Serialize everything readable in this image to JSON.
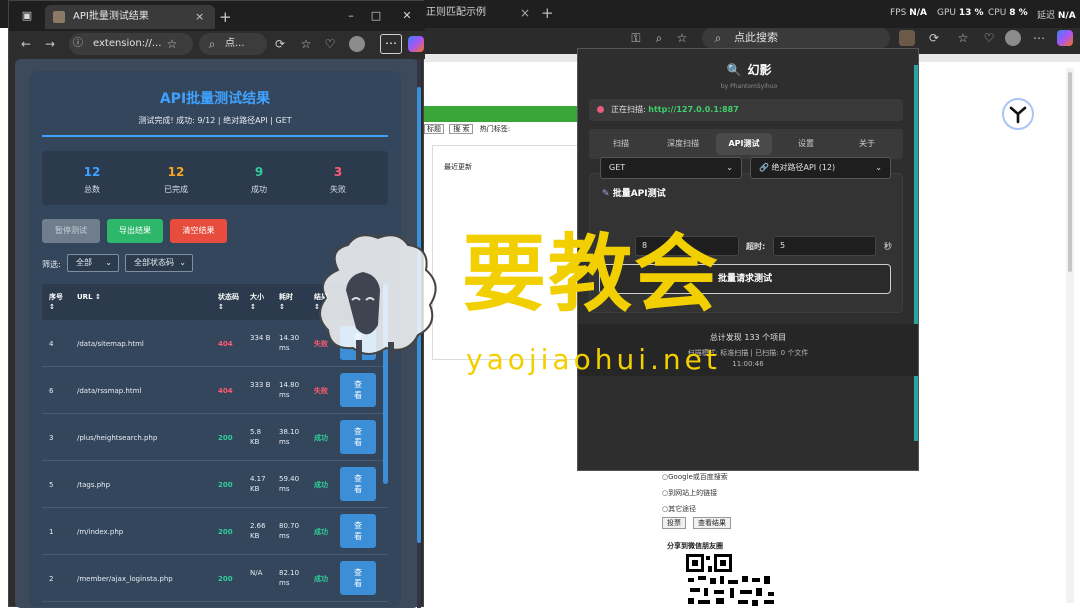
{
  "background_browser": {
    "tab_title": "正则匹配示例",
    "tab_close": "×",
    "new_tab": "+",
    "stats": [
      {
        "label": "FPS",
        "value": "N/A"
      },
      {
        "label": "GPU",
        "value": "13 %"
      },
      {
        "label": "CPU",
        "value": "8 %"
      },
      {
        "label": "延迟",
        "value": "N/A"
      }
    ],
    "search_placeholder": "点此搜索",
    "page": {
      "nav_search_btn": "搜 索",
      "nav_hot": "热门标签:",
      "nav_select": "标题",
      "recent_title": "最近更新",
      "radios": [
        "Google或百度搜索",
        "到网站上的链接",
        "其它途径"
      ],
      "submit_btn": "投票",
      "view_btn": "查看结果",
      "share_title": "分享到微信朋友圈"
    }
  },
  "front_window": {
    "tab_title": "API批量测试结果",
    "tab_close": "×",
    "new_tab": "+",
    "window_controls": {
      "minimize": "–",
      "maximize": "□",
      "close": "✕"
    },
    "url": "extension://...",
    "search_text": "点...",
    "menu": "⋯"
  },
  "results": {
    "title": "API批量测试结果",
    "subtitle": "测试完成! 成功: 9/12 | 绝对路径API | GET",
    "stats": [
      {
        "value": "12",
        "label": "总数",
        "color": "#3fa1ff"
      },
      {
        "value": "12",
        "label": "已完成",
        "color": "#f5a623"
      },
      {
        "value": "9",
        "label": "成功",
        "color": "#2ecc9a"
      },
      {
        "value": "3",
        "label": "失败",
        "color": "#ff5a6e"
      }
    ],
    "buttons": {
      "pause": "暂停测试",
      "export": "导出结果",
      "clear": "清空结果"
    },
    "filter_label": "筛选:",
    "filter_all": "全部",
    "filter_status": "全部状态码",
    "columns": [
      "序号 ↕",
      "URL ↕",
      "状态码 ↕",
      "大小 ↕",
      "耗时 ↕",
      "结果 ↕",
      "操作"
    ],
    "rows": [
      {
        "no": "4",
        "url": "/data/sitemap.html",
        "status": "404",
        "size": "334 B",
        "time": "14.30 ms",
        "result": "失败",
        "ok": false,
        "action": "查看"
      },
      {
        "no": "6",
        "url": "/data/rssmap.html",
        "status": "404",
        "size": "333 B",
        "time": "14.80 ms",
        "result": "失败",
        "ok": false,
        "action": "查看"
      },
      {
        "no": "3",
        "url": "/plus/heightsearch.php",
        "status": "200",
        "size": "5.8 KB",
        "time": "38.10 ms",
        "result": "成功",
        "ok": true,
        "action": "查看"
      },
      {
        "no": "5",
        "url": "/tags.php",
        "status": "200",
        "size": "4.17 KB",
        "time": "59.40 ms",
        "result": "成功",
        "ok": true,
        "action": "查看"
      },
      {
        "no": "1",
        "url": "/m/index.php",
        "status": "200",
        "size": "2.66 KB",
        "time": "80.70 ms",
        "result": "成功",
        "ok": true,
        "action": "查看"
      },
      {
        "no": "2",
        "url": "/member/ajax_loginsta.php",
        "status": "200",
        "size": "N/A",
        "time": "82.10 ms",
        "result": "成功",
        "ok": true,
        "action": "查看"
      }
    ]
  },
  "popup": {
    "title": "幻影",
    "author": "by PhantomSyihuo",
    "scanning_label": "正在扫描:",
    "scanning_url": "http://127.0.0.1:887",
    "tabs": [
      "扫描",
      "深度扫描",
      "API测试",
      "设置",
      "关于"
    ],
    "active_tab": "API测试",
    "batch_title": "批量API测试",
    "method": "GET",
    "api_type": "绝对路径API (12)",
    "concurrency_value": "8",
    "timeout_label": "超时:",
    "timeout_value": "5",
    "timeout_unit": "秒",
    "run_button": "批量请求测试",
    "footer_total": "总计发现 133 个项目",
    "footer_mode": "扫描模式: 标准扫描 | 已扫描: 0 个文件",
    "footer_time": "11:00:46"
  },
  "watermark": {
    "main": "要教会",
    "sub": "yaojiaohui.net"
  }
}
